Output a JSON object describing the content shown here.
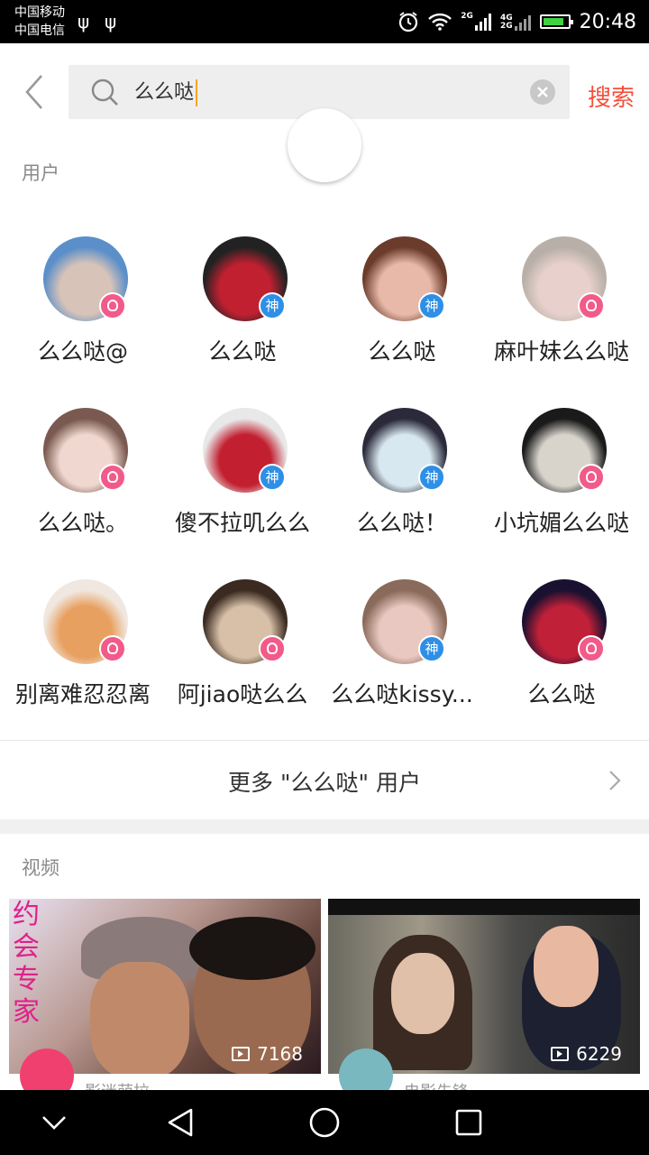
{
  "status_bar": {
    "carrier1": "中国移动",
    "carrier2": "中国电信",
    "usb_icons": [
      "usb-icon",
      "usb-icon"
    ],
    "net1": "2G",
    "net2_top": "4G",
    "net2_bottom": "2G",
    "time": "20:48"
  },
  "search": {
    "query": "么么哒",
    "button_label": "搜索"
  },
  "users_section": {
    "title": "用户",
    "users": [
      {
        "name": "么么哒@",
        "badge": "girl",
        "colors": [
          "#5b8fc9",
          "#d7c3b8"
        ]
      },
      {
        "name": "么么哒",
        "badge": "god",
        "badge_text": "神",
        "colors": [
          "#222222",
          "#c02030"
        ]
      },
      {
        "name": "么么哒",
        "badge": "god",
        "badge_text": "神",
        "colors": [
          "#6b3b2b",
          "#e8b8a8"
        ]
      },
      {
        "name": "麻叶妹么么哒",
        "badge": "girl",
        "colors": [
          "#b8b0a8",
          "#e8d0cc"
        ]
      },
      {
        "name": "么么哒。",
        "badge": "girl",
        "colors": [
          "#7a5a50",
          "#f0d8d0"
        ]
      },
      {
        "name": "傻不拉叽么么",
        "badge": "god",
        "badge_text": "神",
        "colors": [
          "#e8e8e8",
          "#c22030"
        ]
      },
      {
        "name": "么么哒！",
        "badge": "god",
        "badge_text": "神",
        "colors": [
          "#2a2a3a",
          "#d8e8f0"
        ]
      },
      {
        "name": "小坑媚么么哒",
        "badge": "girl",
        "colors": [
          "#1a1a1a",
          "#d8d4cc"
        ]
      },
      {
        "name": "别离难忍忍离",
        "badge": "girl",
        "colors": [
          "#f0e8e0",
          "#e8a060"
        ]
      },
      {
        "name": "阿jiao哒么么",
        "badge": "girl",
        "colors": [
          "#3a2a20",
          "#d8c0a8"
        ]
      },
      {
        "name": "么么哒kissy...",
        "badge": "god",
        "badge_text": "神",
        "colors": [
          "#8a6a5a",
          "#e8c8c0"
        ]
      },
      {
        "name": "么么哒",
        "badge": "girl",
        "colors": [
          "#1a1030",
          "#c02038"
        ]
      }
    ],
    "more_label": "更多 \"么么哒\" 用户"
  },
  "video_section": {
    "title": "视频",
    "videos": [
      {
        "overlay_text": [
          "约",
          "会",
          "专",
          "家"
        ],
        "plays": "7168",
        "author": "影迷萌拉",
        "avatar_color": "#f04070"
      },
      {
        "plays": "6229",
        "author": "电影先锋",
        "avatar_color": "#7ab8c0"
      }
    ]
  },
  "nav_bar": {
    "buttons": [
      "chevron-down-icon",
      "back-triangle-icon",
      "home-circle-icon",
      "recent-square-icon"
    ]
  }
}
